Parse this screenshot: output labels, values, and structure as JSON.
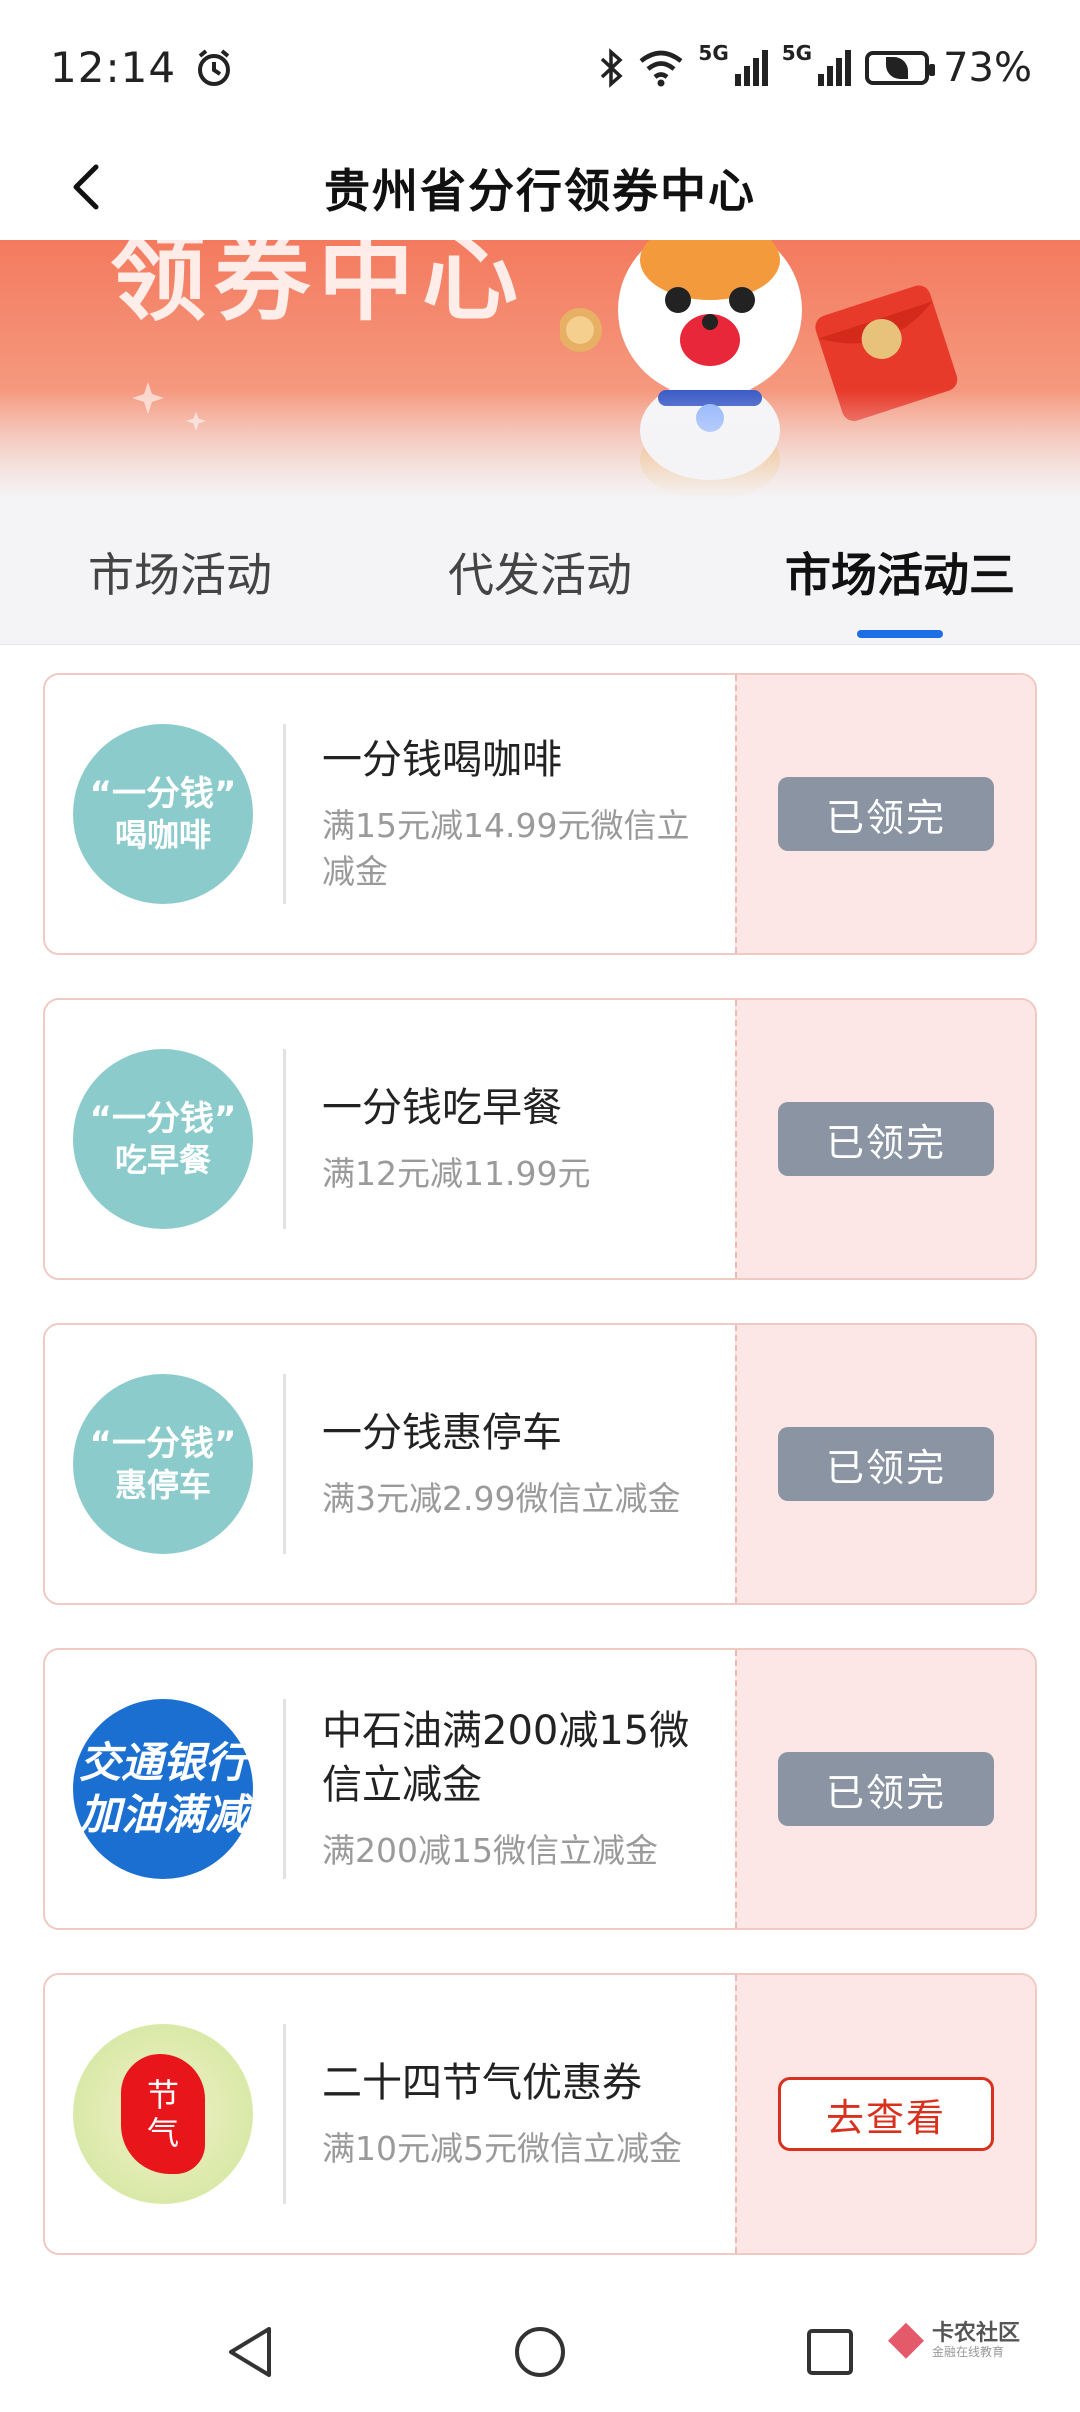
{
  "status_bar": {
    "time": "12:14",
    "battery": "73%",
    "network_1": "5G",
    "network_2": "5G"
  },
  "header": {
    "title": "贵州省分行领券中心"
  },
  "banner": {
    "text": "领券中心"
  },
  "tabs": [
    {
      "label": "市场活动",
      "active": false
    },
    {
      "label": "代发活动",
      "active": false
    },
    {
      "label": "市场活动三",
      "active": true
    }
  ],
  "coupons": [
    {
      "logo_line1": "“一分钱”",
      "logo_line2": "喝咖啡",
      "title": "一分钱喝咖啡",
      "desc": "满15元减14.99元微信立减金",
      "button": "已领完",
      "status": "claimed"
    },
    {
      "logo_line1": "“一分钱”",
      "logo_line2": "吃早餐",
      "title": "一分钱吃早餐",
      "desc": "满12元减11.99元",
      "button": "已领完",
      "status": "claimed"
    },
    {
      "logo_line1": "“一分钱”",
      "logo_line2": "惠停车",
      "title": "一分钱惠停车",
      "desc": "满3元减2.99微信立减金",
      "button": "已领完",
      "status": "claimed"
    },
    {
      "logo_line1": "交通银行",
      "logo_line2": "加油满减",
      "title": "中石油满200减15微信立减金",
      "desc": "满200减15微信立减金",
      "button": "已领完",
      "status": "claimed"
    },
    {
      "logo_line1": "节",
      "logo_line2": "气",
      "title": "二十四节气优惠券",
      "desc": "满10元减5元微信立减金",
      "button": "去查看",
      "status": "available"
    }
  ],
  "watermark": {
    "main": "卡农社区",
    "sub": "金融在线教育"
  },
  "colors": {
    "accent": "#1c6fe6",
    "claimed_button": "#8b94a3",
    "view_button": "#d8321f",
    "card_right_bg": "#fce6e6"
  }
}
